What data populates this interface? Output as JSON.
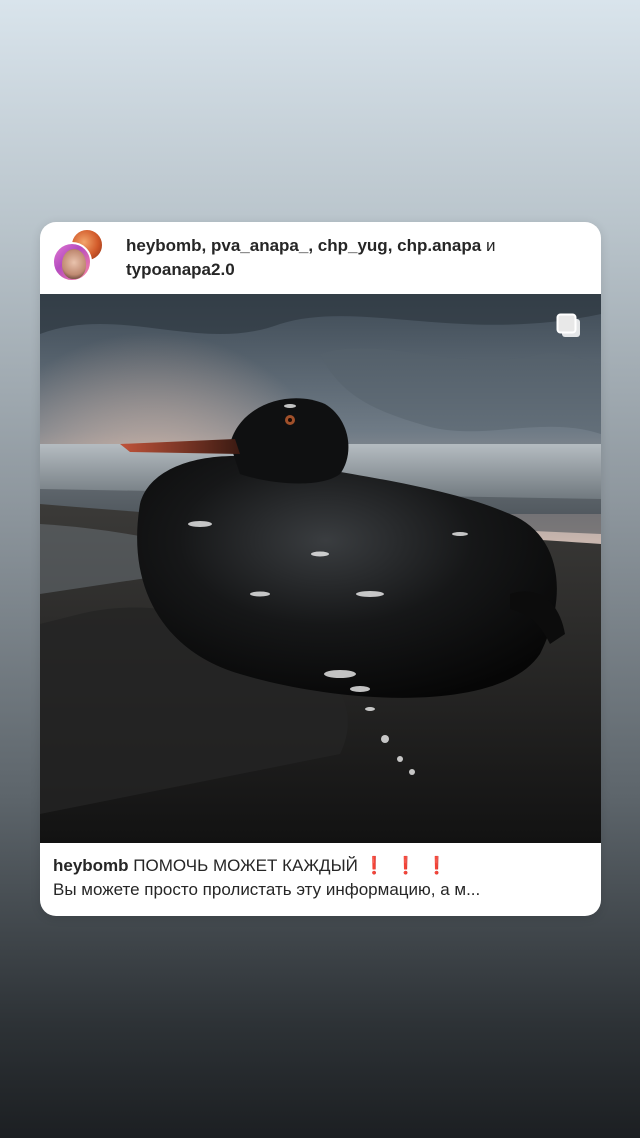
{
  "post": {
    "header": {
      "users": "heybomb, pva_anapa_, chp_yug, chp.anapa",
      "conjunction": " и ",
      "last_user": "typoanapa2.0"
    },
    "image": {
      "icon": "multiple-images-icon"
    },
    "caption": {
      "author": "heybomb",
      "headline": "ПОМОЧЬ МОЖЕТ КАЖДЫЙ",
      "emoji": "❗❗❗",
      "text": "Вы можете просто пролистать эту информацию, а м..."
    }
  },
  "colors": {
    "text": "#262626",
    "exclamation": "#d31b1b",
    "card": "#ffffff"
  }
}
